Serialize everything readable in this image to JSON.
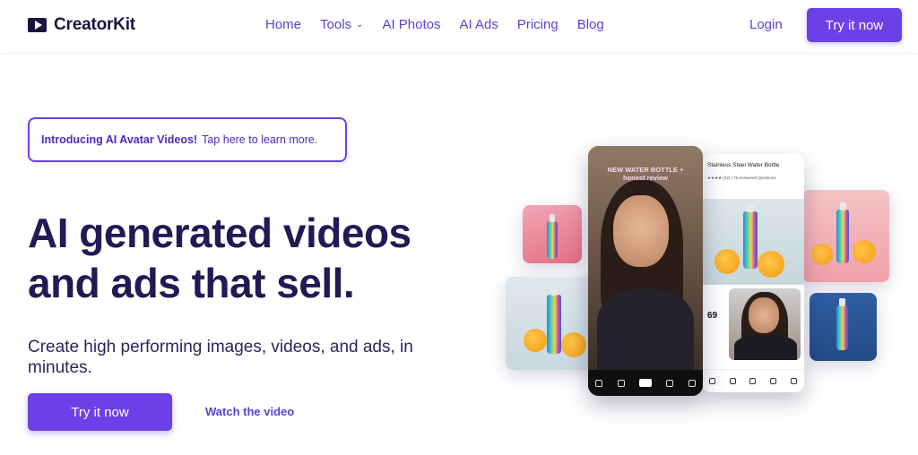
{
  "header": {
    "brand": "CreatorKit",
    "nav": [
      {
        "label": "Home"
      },
      {
        "label": "Tools",
        "has_dropdown": true
      },
      {
        "label": "AI Photos"
      },
      {
        "label": "AI Ads"
      },
      {
        "label": "Pricing"
      },
      {
        "label": "Blog"
      }
    ],
    "login_label": "Login",
    "cta_label": "Try it now"
  },
  "hero": {
    "announcement_strong": "Introducing AI Avatar Videos!",
    "announcement_rest": "Tap here to learn more.",
    "headline_line1": "AI generated videos",
    "headline_line2": "and ads that sell.",
    "subtext": "Create high performing images, videos, and ads, in minutes.",
    "primary_cta": "Try it now",
    "secondary_cta": "Watch the video"
  },
  "collage": {
    "phone_caption": "NEW WATER BOTTLE + honest review",
    "product_title": "Stainless Steel Water Bottle",
    "product_meta": "★★★★ (22) | 78 Answered Questions",
    "product_price": "69"
  },
  "colors": {
    "accent": "#6d3fe6",
    "link": "#5b3fd6",
    "heading": "#221a56"
  }
}
